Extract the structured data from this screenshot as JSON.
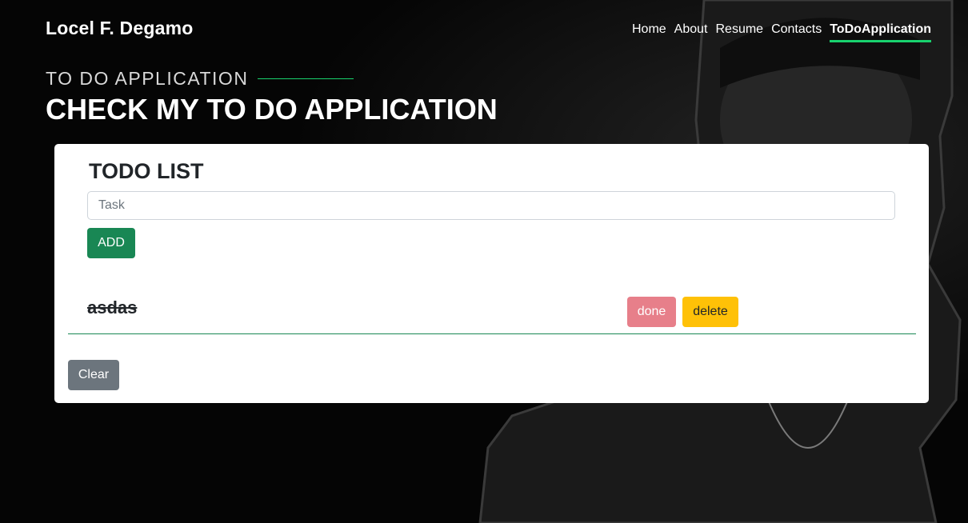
{
  "header": {
    "brand": "Locel F. Degamo",
    "nav": [
      {
        "label": "Home",
        "active": false
      },
      {
        "label": "About",
        "active": false
      },
      {
        "label": "Resume",
        "active": false
      },
      {
        "label": "Contacts",
        "active": false
      },
      {
        "label": "ToDoApplication",
        "active": true
      }
    ]
  },
  "hero": {
    "subtitle": "TO DO APPLICATION",
    "title": "CHECK MY TO DO APPLICATION"
  },
  "todo": {
    "title": "TODO LIST",
    "input_placeholder": "Task",
    "input_value": "",
    "add_label": "ADD",
    "items": [
      {
        "text": "asdas",
        "completed": true,
        "done_label": "done",
        "delete_label": "delete"
      }
    ],
    "clear_label": "Clear"
  },
  "colors": {
    "accent": "#18d26e",
    "add": "#198754",
    "done": "#e77f8a",
    "delete": "#ffc107",
    "clear": "#6c757d"
  }
}
